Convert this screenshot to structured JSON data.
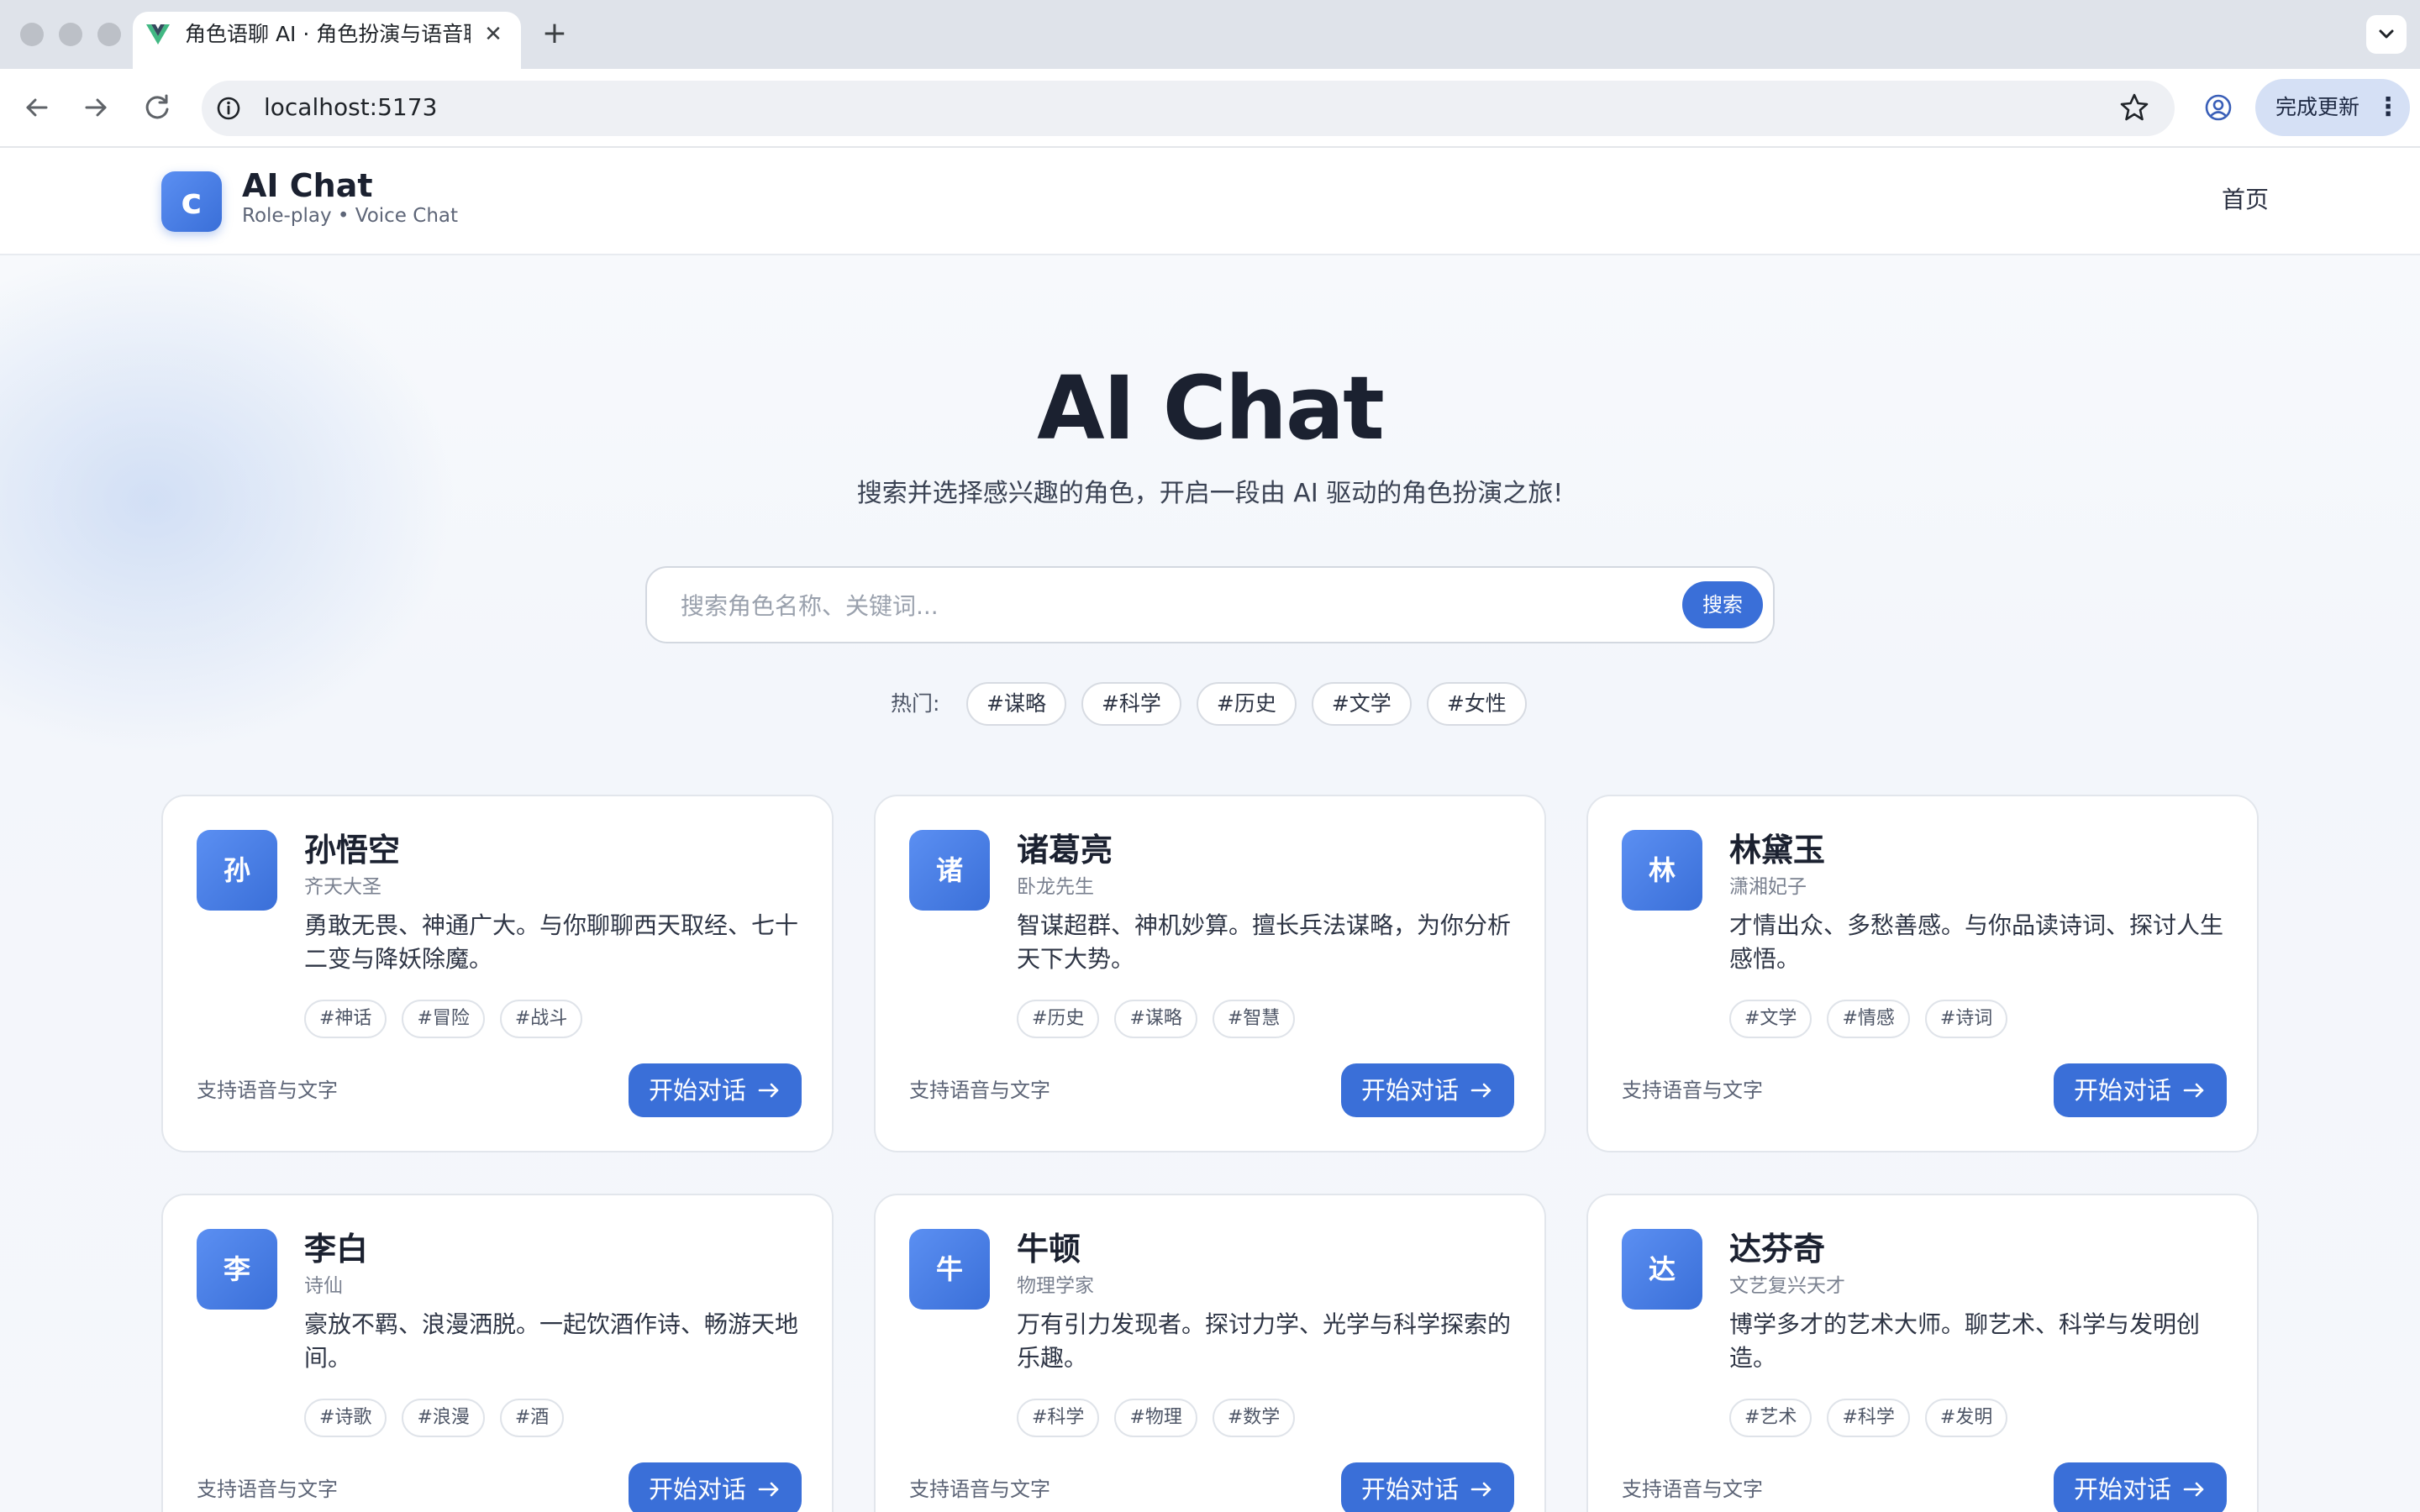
{
  "browser": {
    "tab_title": "角色语聊 AI · 角色扮演与语音聊天",
    "tab_close_glyph": "✕",
    "new_tab_glyph": "+",
    "url": "localhost:5173",
    "update_label": "完成更新",
    "update_menu_glyph": "⋮"
  },
  "header": {
    "logo_letter": "c",
    "brand_name": "AI Chat",
    "brand_sub": "Role-play • Voice Chat",
    "nav_home": "首页"
  },
  "hero": {
    "title": "AI Chat",
    "subtitle": "搜索并选择感兴趣的角色，开启一段由 AI 驱动的角色扮演之旅!"
  },
  "search": {
    "placeholder": "搜索角色名称、关键词...",
    "value": "",
    "button": "搜索"
  },
  "hot": {
    "label": "热门:",
    "tags": [
      "#谋略",
      "#科学",
      "#历史",
      "#文学",
      "#女性"
    ]
  },
  "cards": [
    {
      "avatar": "孙",
      "name": "孙悟空",
      "title": "齐天大圣",
      "desc": "勇敢无畏、神通广大。与你聊聊西天取经、七十二变与降妖除魔。",
      "tags": [
        "#神话",
        "#冒险",
        "#战斗"
      ],
      "support": "支持语音与文字",
      "button": "开始对话"
    },
    {
      "avatar": "诸",
      "name": "诸葛亮",
      "title": "卧龙先生",
      "desc": "智谋超群、神机妙算。擅长兵法谋略，为你分析天下大势。",
      "tags": [
        "#历史",
        "#谋略",
        "#智慧"
      ],
      "support": "支持语音与文字",
      "button": "开始对话"
    },
    {
      "avatar": "林",
      "name": "林黛玉",
      "title": "潇湘妃子",
      "desc": "才情出众、多愁善感。与你品读诗词、探讨人生感悟。",
      "tags": [
        "#文学",
        "#情感",
        "#诗词"
      ],
      "support": "支持语音与文字",
      "button": "开始对话"
    },
    {
      "avatar": "李",
      "name": "李白",
      "title": "诗仙",
      "desc": "豪放不羁、浪漫洒脱。一起饮酒作诗、畅游天地间。",
      "tags": [
        "#诗歌",
        "#浪漫",
        "#酒"
      ],
      "support": "支持语音与文字",
      "button": "开始对话"
    },
    {
      "avatar": "牛",
      "name": "牛顿",
      "title": "物理学家",
      "desc": "万有引力发现者。探讨力学、光学与科学探索的乐趣。",
      "tags": [
        "#科学",
        "#物理",
        "#数学"
      ],
      "support": "支持语音与文字",
      "button": "开始对话"
    },
    {
      "avatar": "达",
      "name": "达芬奇",
      "title": "文艺复兴天才",
      "desc": "博学多才的艺术大师。聊艺术、科学与发明创造。",
      "tags": [
        "#艺术",
        "#科学",
        "#发明"
      ],
      "support": "支持语音与文字",
      "button": "开始对话"
    }
  ],
  "colors": {
    "accent": "#3a6fd8",
    "accent_light": "#5b8ff2",
    "text_dark": "#1b2130",
    "tabstrip": "#dfe3ea"
  },
  "icons": [
    "vue-logo-icon",
    "close-icon",
    "plus-icon",
    "chevron-down-icon",
    "back-arrow-icon",
    "forward-arrow-icon",
    "reload-icon",
    "info-icon",
    "star-icon",
    "profile-icon",
    "kebab-menu-icon",
    "arrow-right-icon"
  ]
}
